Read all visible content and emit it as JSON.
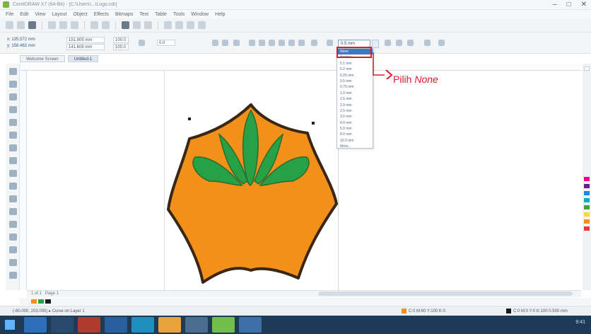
{
  "window": {
    "title": "CorelDRAW X7 (64-Bit) - [C:\\Users\\...\\Logo.cdr]",
    "controls": [
      "–",
      "□",
      "✕"
    ]
  },
  "menubar": {
    "items": [
      "File",
      "Edit",
      "View",
      "Layout",
      "Object",
      "Effects",
      "Bitmaps",
      "Text",
      "Table",
      "Tools",
      "Window",
      "Help"
    ]
  },
  "propbar": {
    "x_label": "x: 135.572 mm",
    "y_label": "y: 158.463 mm",
    "w_label": "151.905 mm",
    "h_label": "141.608 mm",
    "scale_x": "100.0",
    "scale_y": "100.0",
    "angle": "0.0",
    "outline_width": "0.5 mm"
  },
  "doctabs": [
    "Welcome Screen",
    "Untitled-1"
  ],
  "outline_dropdown": {
    "selected": "None",
    "items": [
      "None",
      "Hairline",
      "0.1 mm",
      "0.2 mm",
      "0.25 mm",
      "0.5 mm",
      "0.75 mm",
      "1.0 mm",
      "1.5 mm",
      "2.0 mm",
      "2.5 mm",
      "3.0 mm",
      "4.0 mm",
      "5.0 mm",
      "8.0 mm",
      "10.0 mm",
      "More..."
    ]
  },
  "callout": {
    "prefix": "Pilih ",
    "emphasis": "None"
  },
  "page_nav": "1 of 1",
  "page_label": "Page 1",
  "statusbar": {
    "left": "(-60.000, 203.000) ▸ Curve on Layer 1",
    "fill": "C:0 M:60 Y:100 K:0",
    "outline": "C:0 M:0 Y:0 K:100  0.500 mm"
  },
  "colors": {
    "orange": "#F39019",
    "green": "#27A046",
    "outline": "#3A2614",
    "accent_red": "#E0192B"
  },
  "taskbar": {
    "tray_time": "9:41"
  }
}
